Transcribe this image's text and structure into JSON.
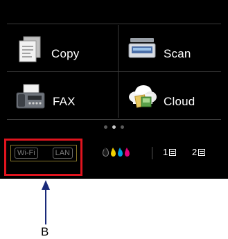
{
  "menu": {
    "tiles": [
      {
        "label": "Copy",
        "icon": "copy-icon"
      },
      {
        "label": "Scan",
        "icon": "scan-icon"
      },
      {
        "label": "FAX",
        "icon": "fax-icon"
      },
      {
        "label": "Cloud",
        "icon": "cloud-icon"
      }
    ]
  },
  "pager": {
    "pages": 3,
    "active_page": 1
  },
  "status": {
    "network": {
      "wifi_label": "Wi-Fi",
      "lan_label": "LAN"
    },
    "ink_colors": [
      "#1a1a1a",
      "#f0d000",
      "#00a0e0",
      "#e0007a"
    ],
    "trays": [
      {
        "label": "1"
      },
      {
        "label": "2"
      }
    ]
  },
  "callout": {
    "label": "B"
  },
  "colors": {
    "screen_bg": "#000000",
    "highlight": "#e0141e",
    "arrow": "#1a2a7a"
  }
}
